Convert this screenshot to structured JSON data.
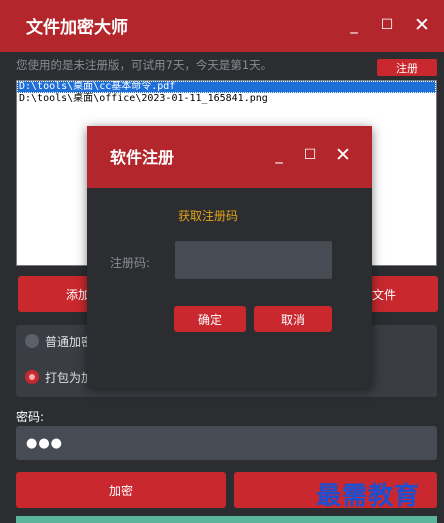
{
  "app": {
    "title": "文件加密大师",
    "minimize_glyph": "_",
    "maximize_glyph": "☐",
    "close_glyph": "✕"
  },
  "notice": {
    "text": "您使用的是未注册版，可试用7天，今天是第1天。",
    "register_label": "注册"
  },
  "file_list": {
    "items": [
      "D:\\tools\\桌面\\cc基本命令.pdf",
      "D:\\tools\\桌面\\office\\2023-01-11_165841.png"
    ],
    "selected_index": 0
  },
  "actions": {
    "add_label": "添加",
    "file_label": "文件"
  },
  "options": {
    "items": [
      {
        "label": "普通加密",
        "selected": false
      },
      {
        "label": "打包为加",
        "selected": true
      }
    ]
  },
  "password": {
    "label": "密码:",
    "masked_value": "●●●"
  },
  "buttons": {
    "encrypt_label": "加密"
  },
  "watermark": "最需教育",
  "dialog": {
    "title": "软件注册",
    "get_code_link": "获取注册码",
    "code_label": "注册码:",
    "code_value": "",
    "confirm_label": "确定",
    "cancel_label": "取消"
  },
  "colors": {
    "accent": "#c8282e",
    "titlebar": "#b3262c",
    "background": "#2b2d31",
    "link": "#e0a21a",
    "watermark": "#1f4fd1",
    "status_bar": "#5bb59a"
  }
}
